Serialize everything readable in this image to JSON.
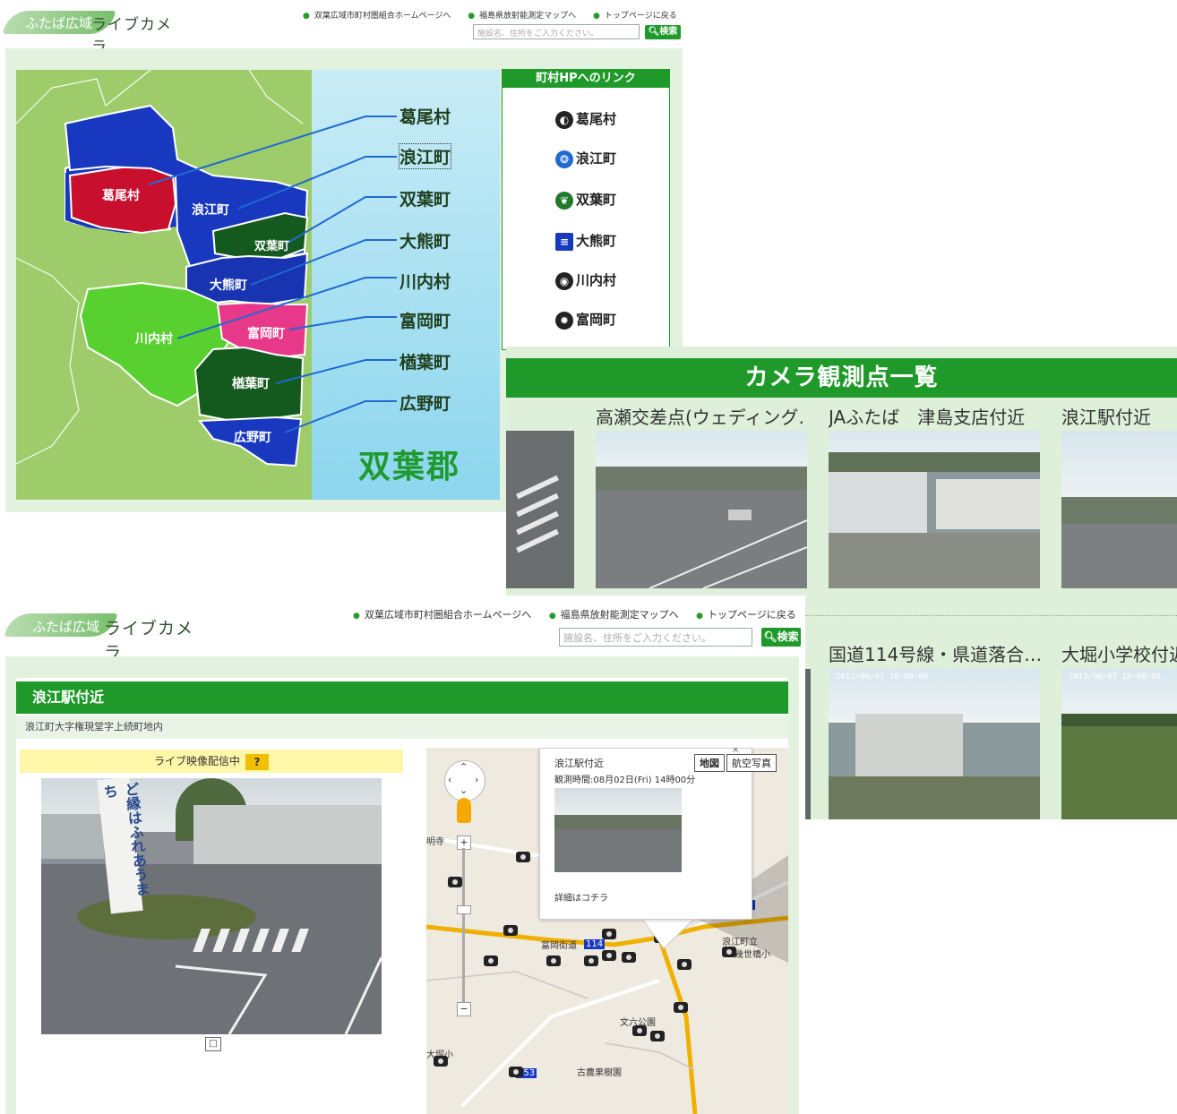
{
  "brand": {
    "logo_part1": "ふたば広域",
    "logo_part2": "ライブカメラ"
  },
  "header": {
    "links": [
      "双葉広域市町村圏組合ホームページへ",
      "福島県放射能測定マップへ",
      "トップページに戻る"
    ],
    "search_placeholder": "施設名、住所をご入力ください。",
    "search_button": "検索"
  },
  "map_panel": {
    "region_labels": [
      "葛尾村",
      "浪江町",
      "双葉町",
      "大熊町",
      "川内村",
      "富岡町",
      "楢葉町",
      "広野町"
    ],
    "town_list": [
      "葛尾村",
      "浪江町",
      "双葉町",
      "大熊町",
      "川内村",
      "富岡町",
      "楢葉町",
      "広野町"
    ],
    "county_name": "双葉郡",
    "colors": {
      "katsurao": "#c8102e",
      "namie": "#1838c0",
      "futaba": "#145a1e",
      "okuma": "#1834b0",
      "kawauchi": "#58d030",
      "tomioka": "#e8388a",
      "naraha": "#145a1e",
      "hirono": "#1838c0",
      "land": "#9fcc6a",
      "sea": "#a8e0f0"
    }
  },
  "link_box": {
    "title": "町村HPへのリンク",
    "items": [
      "葛尾村",
      "浪江町",
      "双葉町",
      "大熊町",
      "川内村",
      "富岡町"
    ]
  },
  "camera_list": {
    "title": "カメラ観測点一覧",
    "row1": [
      "高瀬交差点(ウェディング…",
      "JAふたば　津島支店付近",
      "浪江駅付近"
    ],
    "row2": [
      "国道114号線・県道落合…",
      "大堀小学校付近"
    ],
    "stamp": "2013/08/07 18:00:00"
  },
  "detail": {
    "title": "浪江駅付近",
    "address": "浪江町大字権現堂字上続町地内",
    "live_label": "ライブ映像配信中",
    "help_button": "?",
    "banner_text": "ど縁はふれあうまち",
    "popup": {
      "title": "浪江駅付近",
      "observed": "観測時間:08月02日(Fri) 14時00分",
      "detail_link": "詳細はコチラ"
    },
    "map_type_buttons": [
      "地図",
      "航空写真"
    ],
    "map_labels": [
      "富岡街道",
      "浪江町立",
      "幾世橋小",
      "文六公園",
      "古農果樹園",
      "大堀小",
      "明寺"
    ],
    "route_numbers": [
      "114",
      "253",
      "35"
    ]
  }
}
